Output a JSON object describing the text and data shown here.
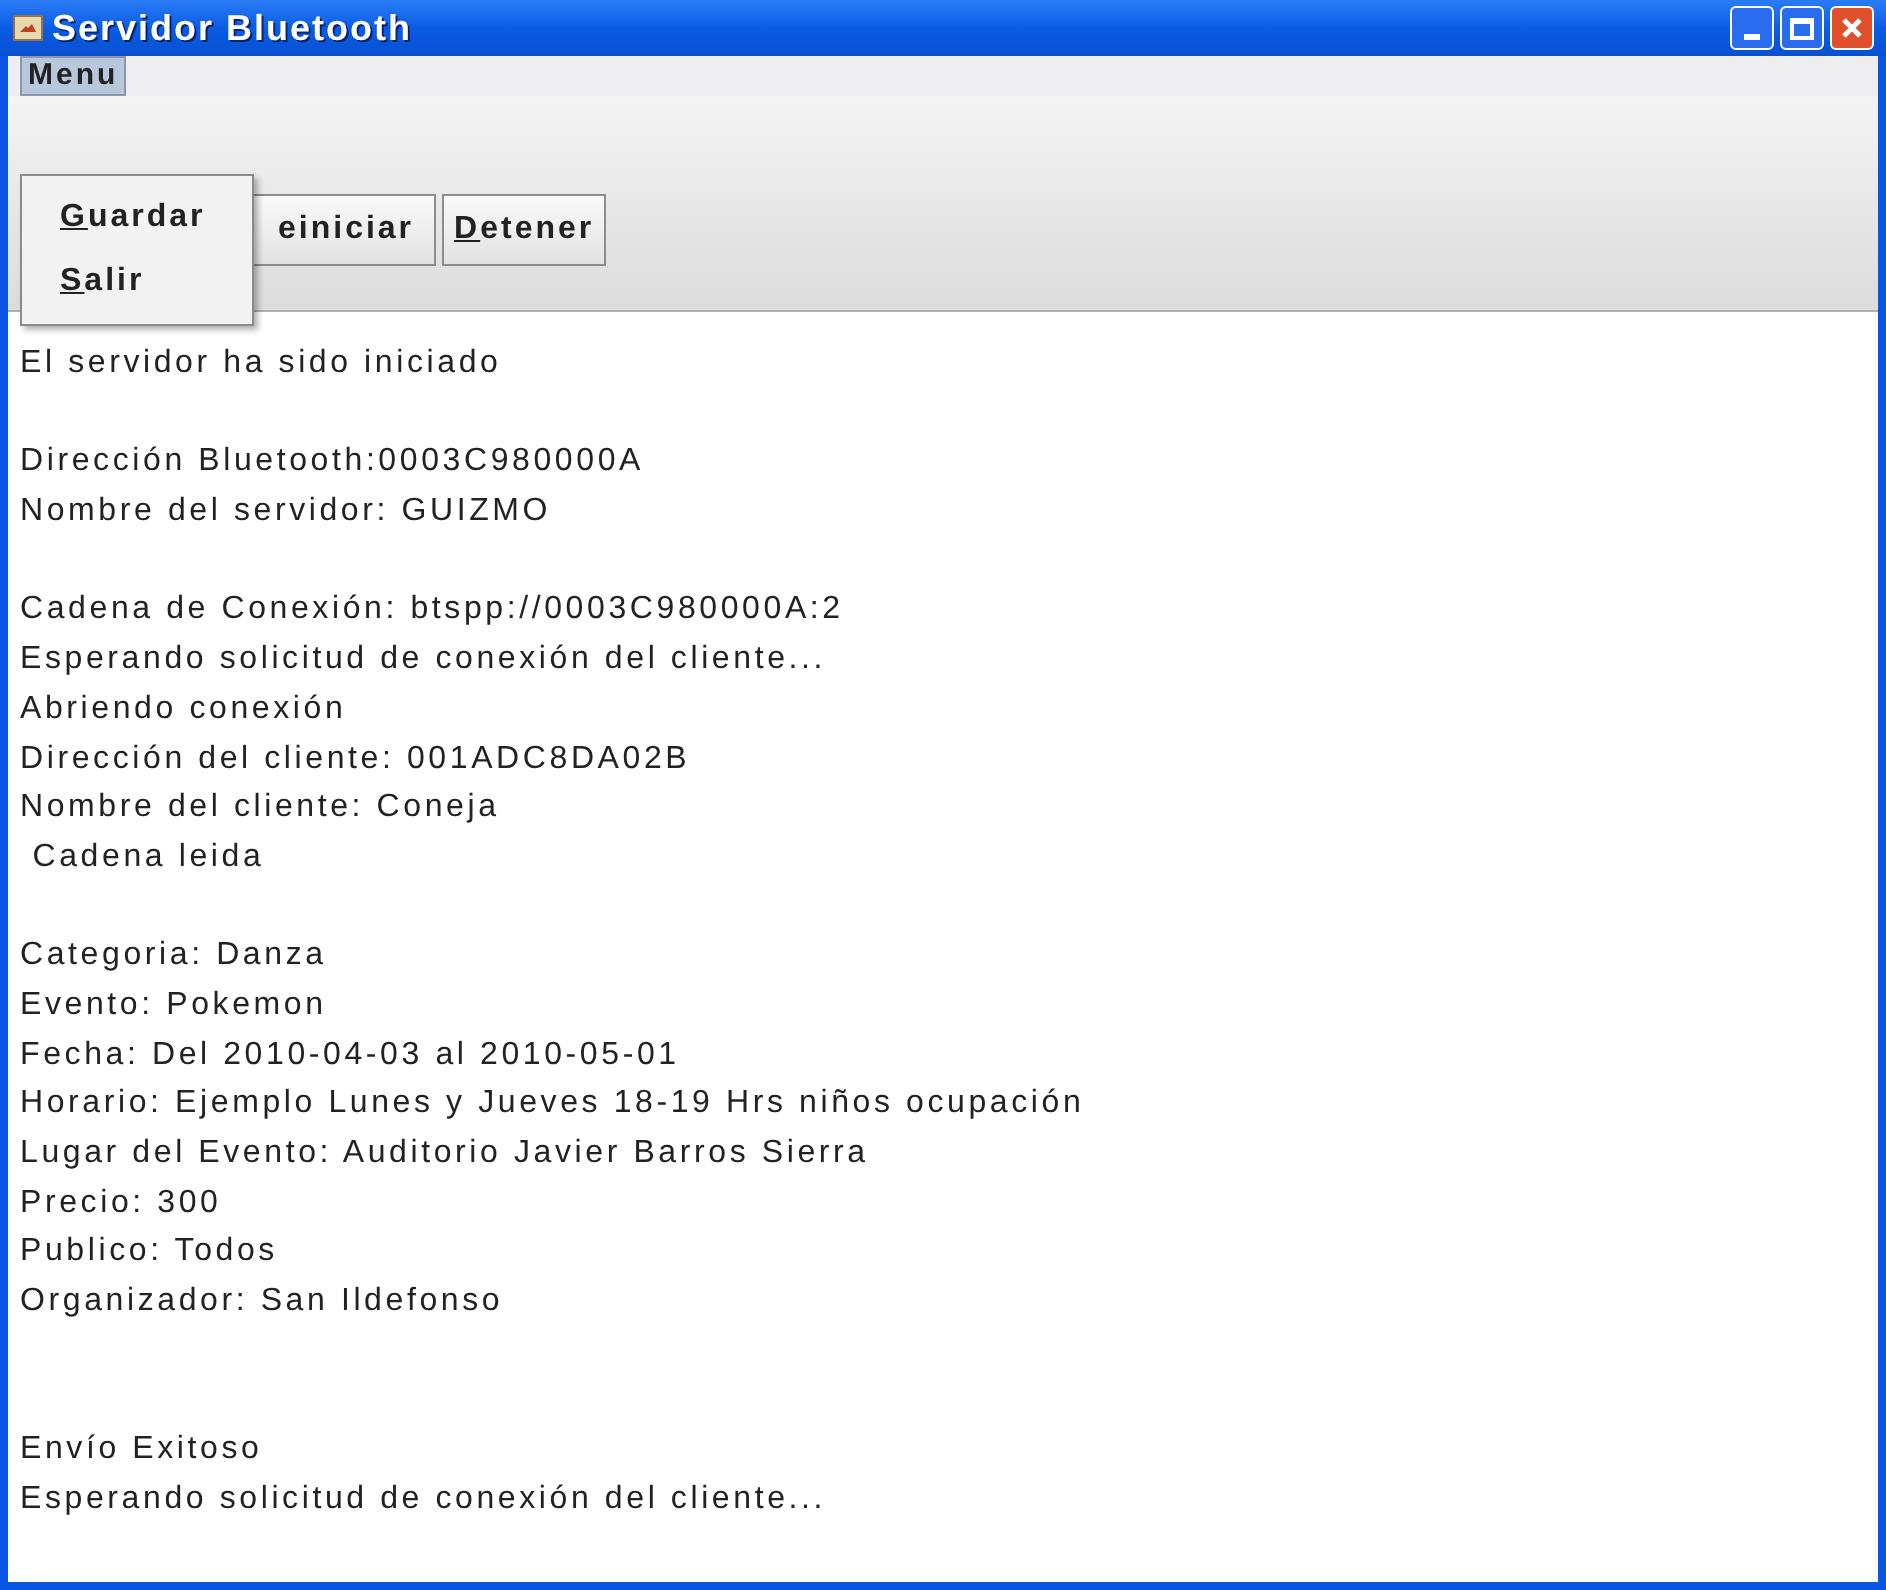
{
  "window": {
    "title": "Servidor Bluetooth"
  },
  "menu_bar": [
    {
      "label": "Menu",
      "selected": true
    }
  ],
  "menu_items": [
    {
      "label": "Guardar"
    },
    {
      "label": "Salir"
    }
  ],
  "toolbar": [
    {
      "label": "einiciar"
    },
    {
      "label": "Detener"
    }
  ],
  "log": [
    {
      "kind": "line",
      "text": "El servidor ha sido iniciado"
    },
    {
      "kind": "blank"
    },
    {
      "kind": "line",
      "text": "Dirección Bluetooth:0003C980000A"
    },
    {
      "kind": "line",
      "text": "Nombre del servidor: GUIZMO"
    },
    {
      "kind": "blank"
    },
    {
      "kind": "line",
      "text": "Cadena de Conexión: btspp://0003C980000A:2"
    },
    {
      "kind": "line",
      "text": "Esperando solicitud de conexión del cliente..."
    },
    {
      "kind": "line",
      "text": "Abriendo conexión"
    },
    {
      "kind": "line",
      "text": "Dirección del cliente: 001ADC8DA02B"
    },
    {
      "kind": "line",
      "text": "Nombre del cliente: Coneja"
    },
    {
      "kind": "line",
      "text": " Cadena leida"
    },
    {
      "kind": "blank"
    },
    {
      "kind": "line",
      "text": "Categoria: Danza"
    },
    {
      "kind": "line",
      "text": "Evento: Pokemon"
    },
    {
      "kind": "line",
      "text": "Fecha: Del 2010-04-03 al 2010-05-01"
    },
    {
      "kind": "line",
      "text": "Horario: Ejemplo Lunes y Jueves 18-19 Hrs niños ocupación"
    },
    {
      "kind": "line",
      "text": "Lugar del Evento: Auditorio Javier Barros Sierra"
    },
    {
      "kind": "line",
      "text": "Precio: 300"
    },
    {
      "kind": "line",
      "text": "Publico: Todos"
    },
    {
      "kind": "line",
      "text": "Organizador: San Ildefonso"
    },
    {
      "kind": "blank"
    },
    {
      "kind": "blank"
    },
    {
      "kind": "line",
      "text": "Envío Exitoso"
    },
    {
      "kind": "line",
      "text": "Esperando solicitud de conexión del cliente..."
    }
  ]
}
